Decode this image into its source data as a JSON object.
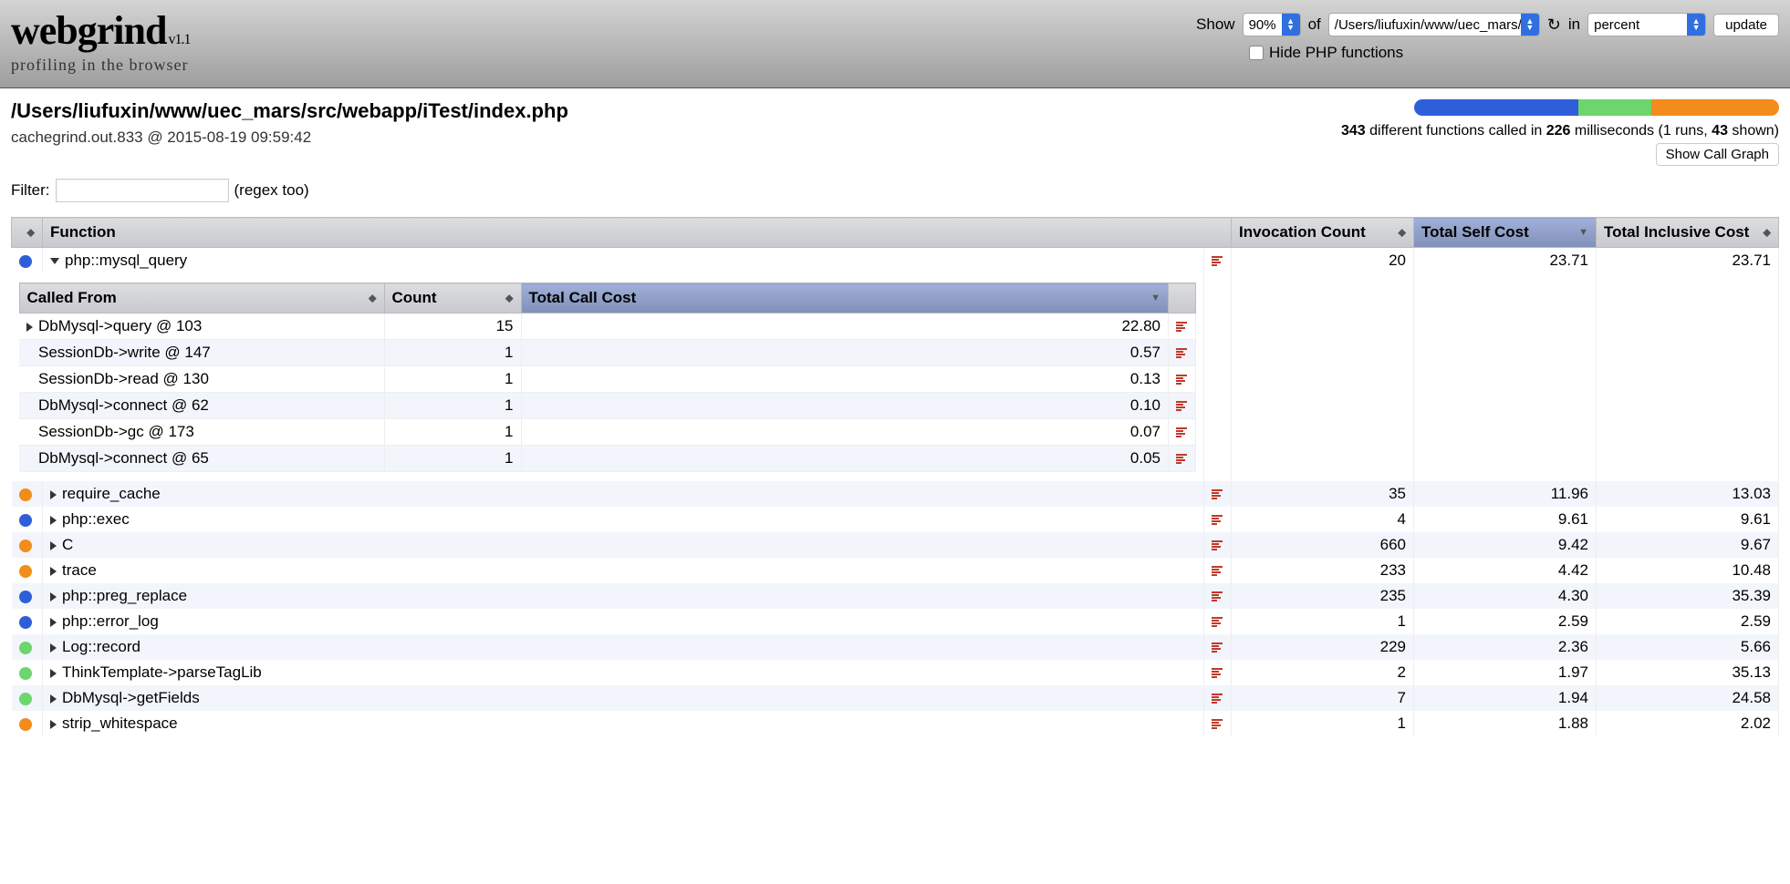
{
  "header": {
    "logo": "webgrind",
    "version": "v1.1",
    "tagline": "profiling in the browser",
    "show_label": "Show",
    "of_label": "of",
    "in_label": "in",
    "show_pct": "90%",
    "file_path": "/Users/liufuxin/www/uec_mars/s",
    "format": "percent",
    "update_btn": "update",
    "hide_php_label": "Hide PHP functions"
  },
  "info": {
    "file_title": "/Users/liufuxin/www/uec_mars/src/webapp/iTest/index.php",
    "file_meta": "cachegrind.out.833 @ 2015-08-19 09:59:42",
    "filter_label": "Filter:",
    "filter_hint": "(regex too)",
    "stats_fncount": "343",
    "stats_text1": " different functions called in ",
    "stats_ms": "226",
    "stats_text2": " milliseconds (1 runs, ",
    "stats_shown": "43",
    "stats_text3": " shown)",
    "callgraph_btn": "Show Call Graph"
  },
  "columns": {
    "function": "Function",
    "invocation": "Invocation Count",
    "self_cost": "Total Self Cost",
    "incl_cost": "Total Inclusive Cost"
  },
  "sub_columns": {
    "called_from": "Called From",
    "count": "Count",
    "total_call_cost": "Total Call Cost"
  },
  "rows": [
    {
      "dot": "blue",
      "expanded": true,
      "name": "php::mysql_query",
      "inv": "20",
      "self": "23.71",
      "incl": "23.71",
      "has_tri_arrow": false,
      "sub": [
        {
          "arrow": true,
          "name": "DbMysql->query @ 103",
          "count": "15",
          "cost": "22.80"
        },
        {
          "arrow": false,
          "name": "SessionDb->write @ 147",
          "count": "1",
          "cost": "0.57"
        },
        {
          "arrow": false,
          "name": "SessionDb->read @ 130",
          "count": "1",
          "cost": "0.13"
        },
        {
          "arrow": false,
          "name": "DbMysql->connect @ 62",
          "count": "1",
          "cost": "0.10"
        },
        {
          "arrow": false,
          "name": "SessionDb->gc @ 173",
          "count": "1",
          "cost": "0.07"
        },
        {
          "arrow": false,
          "name": "DbMysql->connect @ 65",
          "count": "1",
          "cost": "0.05"
        }
      ]
    },
    {
      "dot": "orange",
      "name": "require_cache",
      "inv": "35",
      "self": "11.96",
      "incl": "13.03"
    },
    {
      "dot": "blue",
      "name": "php::exec",
      "inv": "4",
      "self": "9.61",
      "incl": "9.61"
    },
    {
      "dot": "orange",
      "name": "C",
      "inv": "660",
      "self": "9.42",
      "incl": "9.67"
    },
    {
      "dot": "orange",
      "name": "trace",
      "inv": "233",
      "self": "4.42",
      "incl": "10.48"
    },
    {
      "dot": "blue",
      "name": "php::preg_replace",
      "inv": "235",
      "self": "4.30",
      "incl": "35.39"
    },
    {
      "dot": "blue",
      "name": "php::error_log",
      "inv": "1",
      "self": "2.59",
      "incl": "2.59"
    },
    {
      "dot": "green",
      "name": "Log::record",
      "inv": "229",
      "self": "2.36",
      "incl": "5.66"
    },
    {
      "dot": "green",
      "name": "ThinkTemplate->parseTagLib",
      "inv": "2",
      "self": "1.97",
      "incl": "35.13"
    },
    {
      "dot": "green",
      "name": "DbMysql->getFields",
      "inv": "7",
      "self": "1.94",
      "incl": "24.58"
    },
    {
      "dot": "orange",
      "name": "strip_whitespace",
      "inv": "1",
      "self": "1.88",
      "incl": "2.02"
    }
  ]
}
